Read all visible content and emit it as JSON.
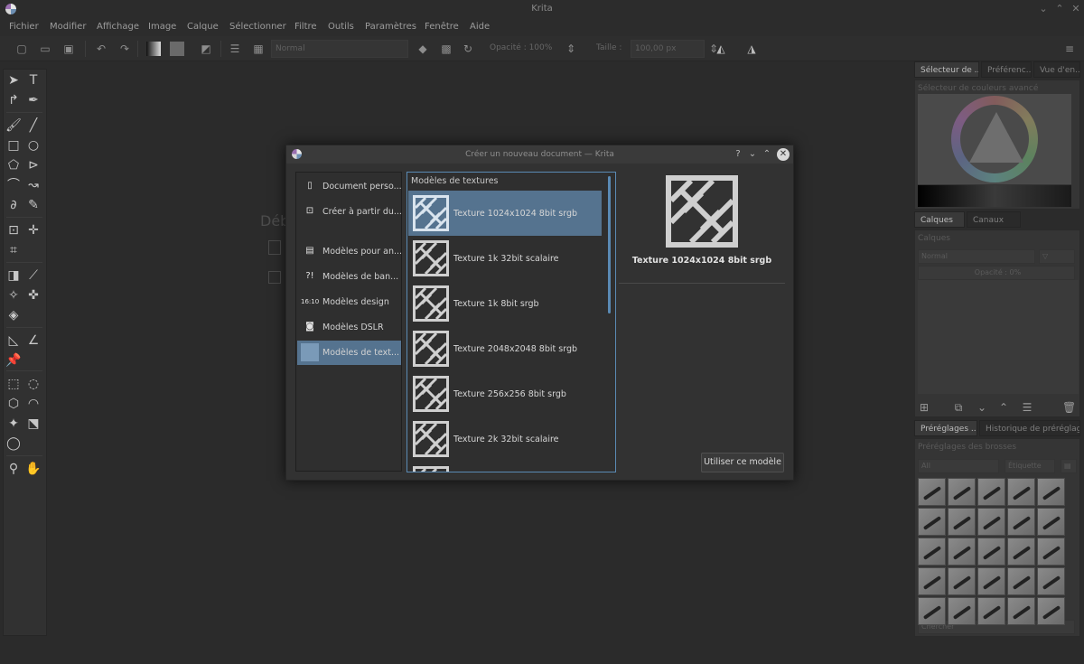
{
  "window": {
    "title": "Krita"
  },
  "menu": [
    "Fichier",
    "Modifier",
    "Affichage",
    "Image",
    "Calque",
    "Sélectionner",
    "Filtre",
    "Outils",
    "Paramètres",
    "Fenêtre",
    "Aide"
  ],
  "toolbar": {
    "blend_mode": "Normal",
    "opacity_label": "Opacité : 100%",
    "size_label": "Taille :",
    "size_value": "100,00 px"
  },
  "canvas": {
    "welcome_title": "Déb"
  },
  "dockers": {
    "top_tabs": [
      "Sélecteur de ...",
      "Préférenc...",
      "Vue d'en..."
    ],
    "color_header": "Sélecteur de couleurs avancé",
    "layer_tabs": [
      "Calques",
      "Canaux"
    ],
    "layers_header": "Calques",
    "layers_blend": "Normal",
    "layers_opacity": "Opacité : 0%",
    "preset_tabs": [
      "Préréglages ...",
      "Historique de préréglag..."
    ],
    "presets_header": "Préréglages des brosses",
    "presets_filter": "All",
    "presets_tag": "Étiquette",
    "presets_search": "Chercher"
  },
  "dialog": {
    "title": "Créer un nouveau document — Krita",
    "categories": [
      {
        "label": "Document perso...",
        "icon": "document-icon"
      },
      {
        "label": "Créer à partir du...",
        "icon": "document-add-icon"
      },
      {
        "label": "Modèles pour an...",
        "icon": "film-icon"
      },
      {
        "label": "Modèles de ban...",
        "icon": "comic-icon"
      },
      {
        "label": "Modèles design",
        "icon": "design-icon"
      },
      {
        "label": "Modèles DSLR",
        "icon": "camera-icon"
      },
      {
        "label": "Modèles de text...",
        "icon": "texture-icon"
      }
    ],
    "templates_header": "Modèles de textures",
    "templates": [
      "Texture 1024x1024 8bit srgb",
      "Texture 1k 32bit scalaire",
      "Texture 1k 8bit srgb",
      "Texture 2048x2048 8bit srgb",
      "Texture 256x256 8bit srgb",
      "Texture 2k 32bit scalaire"
    ],
    "preview_name": "Texture 1024x1024 8bit srgb",
    "use_button": "Utiliser ce modèle"
  }
}
